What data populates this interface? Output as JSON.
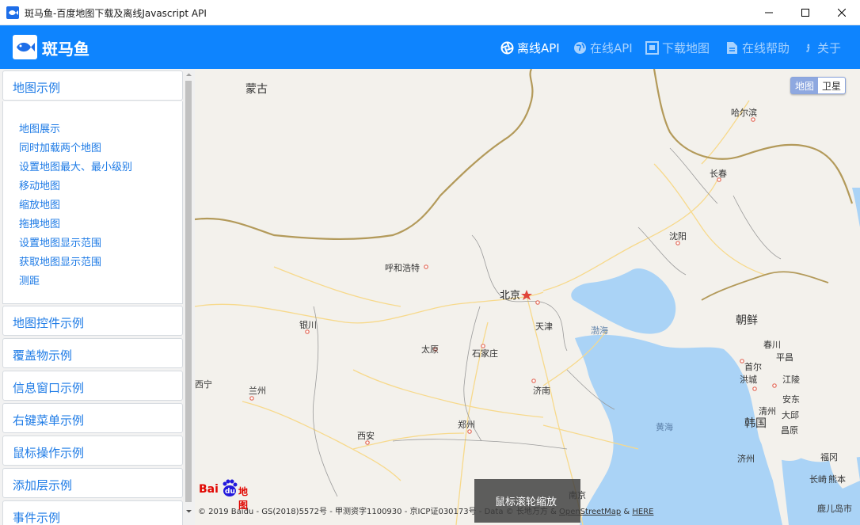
{
  "window": {
    "title": "斑马鱼-百度地图下载及离线Javascript API"
  },
  "header": {
    "brand": "斑马鱼",
    "nav": [
      {
        "label": "离线API",
        "icon": "aperture-icon",
        "active": true
      },
      {
        "label": "在线API",
        "icon": "globe-icon",
        "active": false
      },
      {
        "label": "下载地图",
        "icon": "image-icon",
        "active": false
      },
      {
        "label": "在线帮助",
        "icon": "document-icon",
        "active": false
      },
      {
        "label": "关于",
        "icon": "info-icon",
        "active": false
      }
    ]
  },
  "sidebar": {
    "sections": [
      {
        "label": "地图示例",
        "expanded": true
      },
      {
        "label": "地图控件示例"
      },
      {
        "label": "覆盖物示例"
      },
      {
        "label": "信息窗口示例"
      },
      {
        "label": "右键菜单示例"
      },
      {
        "label": "鼠标操作示例"
      },
      {
        "label": "添加层示例"
      },
      {
        "label": "事件示例"
      }
    ],
    "links": [
      "地图展示",
      "同时加载两个地图",
      "设置地图最大、最小级别",
      "移动地图",
      "缩放地图",
      "拖拽地图",
      "设置地图显示范围",
      "获取地图显示范围",
      "测距"
    ]
  },
  "map": {
    "type_switch": {
      "map": "地图",
      "satellite": "卫星",
      "selected": "map"
    },
    "labels": {
      "mongolia": "蒙古",
      "harbin": "哈尔滨",
      "changchun": "长春",
      "shenyang": "沈阳",
      "hohhot": "呼和浩特",
      "beijing": "北京",
      "tianjin": "天津",
      "bohai": "渤海",
      "north_korea": "朝鲜",
      "yinchuan": "银川",
      "taiyuan": "太原",
      "shijiazhuang": "石家庄",
      "chuncheon": "春川",
      "pyeongchang": "平昌",
      "seoul": "首尔",
      "gangneung": "江陵",
      "hongcheon": "洪城",
      "andong": "安东",
      "daegu": "大邱",
      "cheongju": "清州",
      "changwon": "昌原",
      "xining": "西宁",
      "lanzhou": "兰州",
      "jinan": "济南",
      "south_korea": "韩国",
      "yellow_sea": "黄海",
      "xian": "西安",
      "zhengzhou": "郑州",
      "jeju": "济州",
      "fukuoka": "福冈",
      "nanjing": "南京",
      "nagasaki": "长崎",
      "kumamoto": "熊本",
      "kagoshima": "鹿儿岛市"
    },
    "copyright_main": "© 2019 Baidu - GS(2018)5572号 - 甲测资字1100930 - 京ICP证030173号 - Data © 长地万方 & ",
    "osm": "OpenStreetMap",
    "amp": " & ",
    "here": "HERE",
    "baidu_logo": {
      "bai": "Bai",
      "du": "du",
      "ditu": "地图"
    },
    "zoom_tip": "鼠标滚轮缩放",
    "colors": {
      "land": "#f3f1ec",
      "sea": "#aad3f6",
      "border": "#b39a5a",
      "road": "#f7d98b"
    }
  }
}
